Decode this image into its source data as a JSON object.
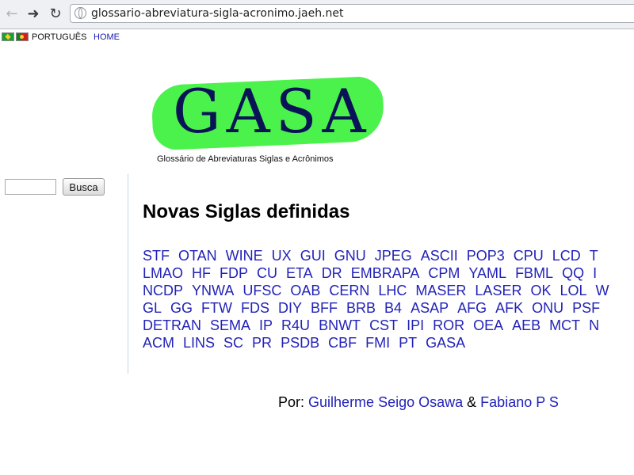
{
  "browser": {
    "url": "glossario-abreviatura-sigla-acronimo.jaeh.net",
    "back_icon": "back-arrow-icon",
    "forward_icon": "forward-arrow-icon",
    "reload_icon": "reload-icon"
  },
  "language": {
    "label": "PORTUGUÊS",
    "home": "HOME"
  },
  "logo": {
    "text": "GASA",
    "tagline": "Glossário de Abreviaturas Siglas e Acrônimos",
    "colors": {
      "blob": "#4cf24c",
      "text": "#0b1357"
    }
  },
  "search": {
    "value": "",
    "button_label": "Busca"
  },
  "main": {
    "title": "Novas Siglas definidas",
    "acronym_rows": [
      [
        "STF",
        "OTAN",
        "WINE",
        "UX",
        "GUI",
        "GNU",
        "JPEG",
        "ASCII",
        "POP3",
        "CPU",
        "LCD",
        "T"
      ],
      [
        "LMAO",
        "HF",
        "FDP",
        "CU",
        "ETA",
        "DR",
        "EMBRAPA",
        "CPM",
        "YAML",
        "FBML",
        "QQ",
        "I"
      ],
      [
        "NCDP",
        "YNWA",
        "UFSC",
        "OAB",
        "CERN",
        "LHC",
        "MASER",
        "LASER",
        "OK",
        "LOL",
        "W"
      ],
      [
        "GL",
        "GG",
        "FTW",
        "FDS",
        "DIY",
        "BFF",
        "BRB",
        "B4",
        "ASAP",
        "AFG",
        "AFK",
        "ONU",
        "PSF"
      ],
      [
        "DETRAN",
        "SEMA",
        "IP",
        "R4U",
        "BNWT",
        "CST",
        "IPI",
        "ROR",
        "OEA",
        "AEB",
        "MCT",
        "N"
      ],
      [
        "ACM",
        "LINS",
        "SC",
        "PR",
        "PSDB",
        "CBF",
        "FMI",
        "PT",
        "GASA"
      ]
    ]
  },
  "credits": {
    "prefix": "Por:",
    "author1": "Guilherme Seigo Osawa",
    "separator": "&",
    "author2": "Fabiano P S"
  }
}
